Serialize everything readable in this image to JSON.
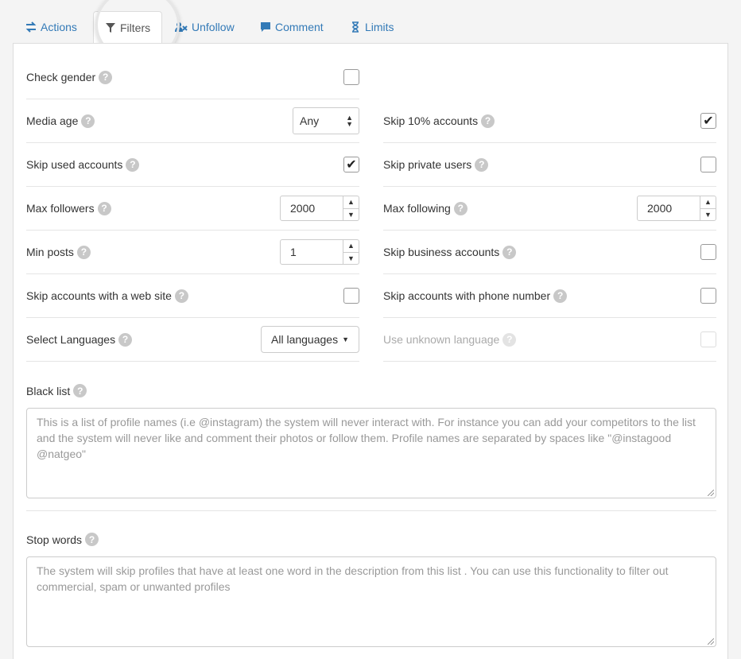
{
  "tabs": [
    {
      "label": "Actions",
      "icon": "exchange-icon"
    },
    {
      "label": "Filters",
      "icon": "filter-icon"
    },
    {
      "label": "Unfollow",
      "icon": "user-times-icon"
    },
    {
      "label": "Comment",
      "icon": "comment-icon"
    },
    {
      "label": "Limits",
      "icon": "hourglass-icon"
    }
  ],
  "active_tab": "Filters",
  "left": {
    "check_gender": {
      "label": "Check gender",
      "checked": false
    },
    "media_age": {
      "label": "Media age",
      "value": "Any"
    },
    "skip_used": {
      "label": "Skip used accounts",
      "checked": true
    },
    "max_followers": {
      "label": "Max followers",
      "value": "2000"
    },
    "min_posts": {
      "label": "Min posts",
      "value": "1"
    },
    "skip_website": {
      "label": "Skip accounts with a web site",
      "checked": false
    },
    "languages": {
      "label": "Select Languages",
      "value": "All languages"
    }
  },
  "right": {
    "skip_10": {
      "label": "Skip 10% accounts",
      "checked": true
    },
    "skip_private": {
      "label": "Skip private users",
      "checked": false
    },
    "max_following": {
      "label": "Max following",
      "value": "2000"
    },
    "skip_business": {
      "label": "Skip business accounts",
      "checked": false
    },
    "skip_phone": {
      "label": "Skip accounts with phone number",
      "checked": false
    },
    "unknown_language": {
      "label": "Use unknown language",
      "checked": false,
      "disabled": true
    }
  },
  "black_list": {
    "label": "Black list",
    "placeholder": "This is a list of profile names (i.e @instagram) the system will never interact with. For instance you can add your competitors to the list and the system will never like and comment their photos or follow them. Profile names are separated by spaces like \"@instagood @natgeo\""
  },
  "stop_words": {
    "label": "Stop words",
    "placeholder": "The system will skip profiles that have at least one word in the description from this list . You can use this functionality to filter out commercial, spam or unwanted profiles"
  },
  "help_glyph": "?",
  "check_glyph": "✔",
  "colors": {
    "link": "#337ab7",
    "help_badge": "#c8c8c8",
    "border": "#dddddd"
  }
}
